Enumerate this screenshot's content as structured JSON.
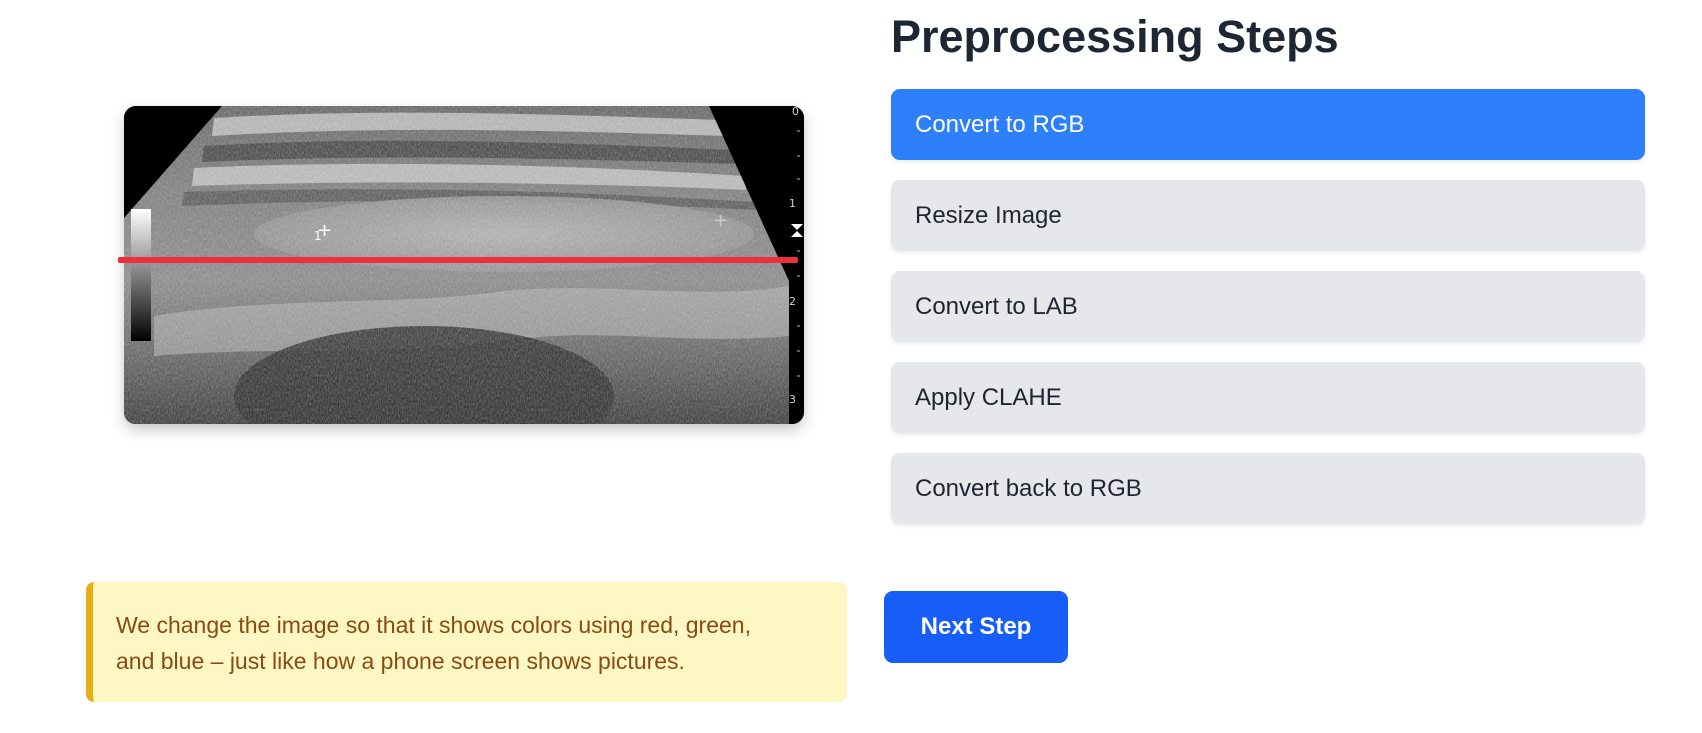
{
  "image": {
    "alt": "Ultrasound scan",
    "depth_scale": [
      "0",
      "1",
      "2",
      "3"
    ],
    "markers": [
      "1",
      "+"
    ]
  },
  "steps": {
    "title": "Preprocessing Steps",
    "items": [
      {
        "label": "Convert to RGB",
        "active": true
      },
      {
        "label": "Resize Image",
        "active": false
      },
      {
        "label": "Convert to LAB",
        "active": false
      },
      {
        "label": "Apply CLAHE",
        "active": false
      },
      {
        "label": "Convert back to RGB",
        "active": false
      }
    ]
  },
  "note": {
    "text": "We change the image so that it shows colors using red, green, and blue – just like how a phone screen shows pictures."
  },
  "next_button": {
    "label": "Next Step"
  },
  "colors": {
    "active_step": "#2e7ffa",
    "inactive_step": "#e6e7eb",
    "next_button": "#175ef8",
    "note_background": "#fdf7c3",
    "note_border": "#e9ad15",
    "scan_line": "#ef2f3c"
  }
}
